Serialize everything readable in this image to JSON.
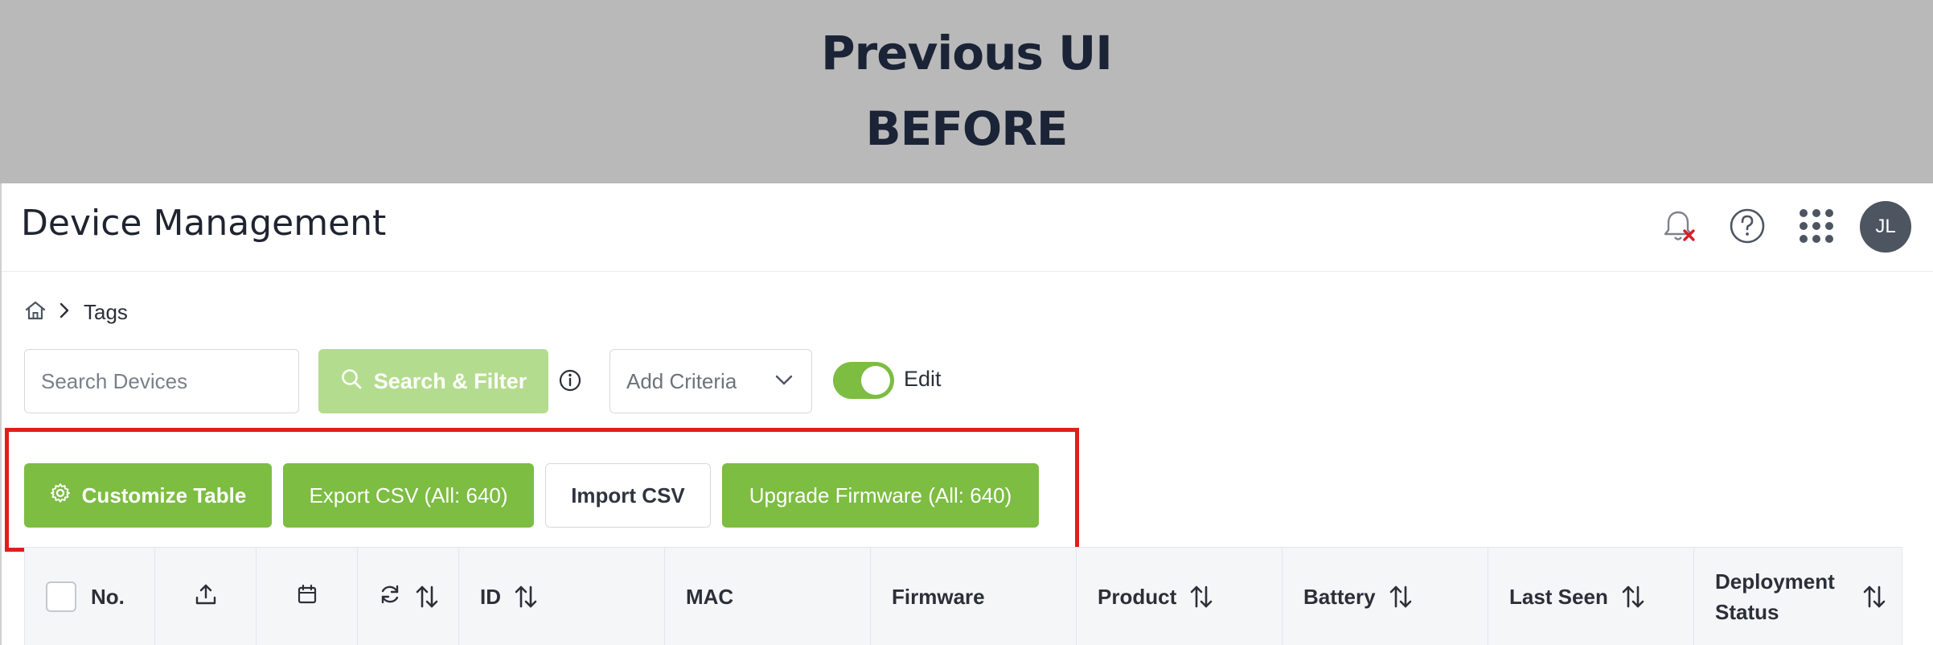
{
  "banner": {
    "line1": "Previous UI",
    "line2": "BEFORE"
  },
  "header": {
    "title": "Device Management",
    "avatar_initials": "JL",
    "icons": [
      "bell-muted-icon",
      "help-icon",
      "apps-grid-icon"
    ]
  },
  "breadcrumb": {
    "home_icon": "home-icon",
    "current": "Tags"
  },
  "search": {
    "placeholder": "Search Devices",
    "value": ""
  },
  "toolbar": {
    "search_filter_label": "Search & Filter",
    "criteria_label": "Add Criteria",
    "edit_label": "Edit",
    "edit_on": true
  },
  "actions": {
    "customize_label": "Customize Table",
    "export_label": "Export CSV (All: 640)",
    "import_label": "Import CSV",
    "upgrade_label": "Upgrade Firmware (All: 640)"
  },
  "table": {
    "columns": {
      "no": "No.",
      "upload_icon": "upload-icon",
      "calendar_icon": "calendar-icon",
      "refresh_icon": "refresh-icon",
      "id": "ID",
      "mac": "MAC",
      "firmware": "Firmware",
      "product": "Product",
      "battery": "Battery",
      "last_seen": "Last Seen",
      "deployment_line1": "Deployment",
      "deployment_line2": "Status"
    }
  },
  "colors": {
    "primary_green": "#7cbd42",
    "disabled_green": "#b4dc8f",
    "highlight_red": "#e11d1d",
    "banner_gray": "#b9b9b9",
    "avatar_bg": "#4d5561"
  }
}
